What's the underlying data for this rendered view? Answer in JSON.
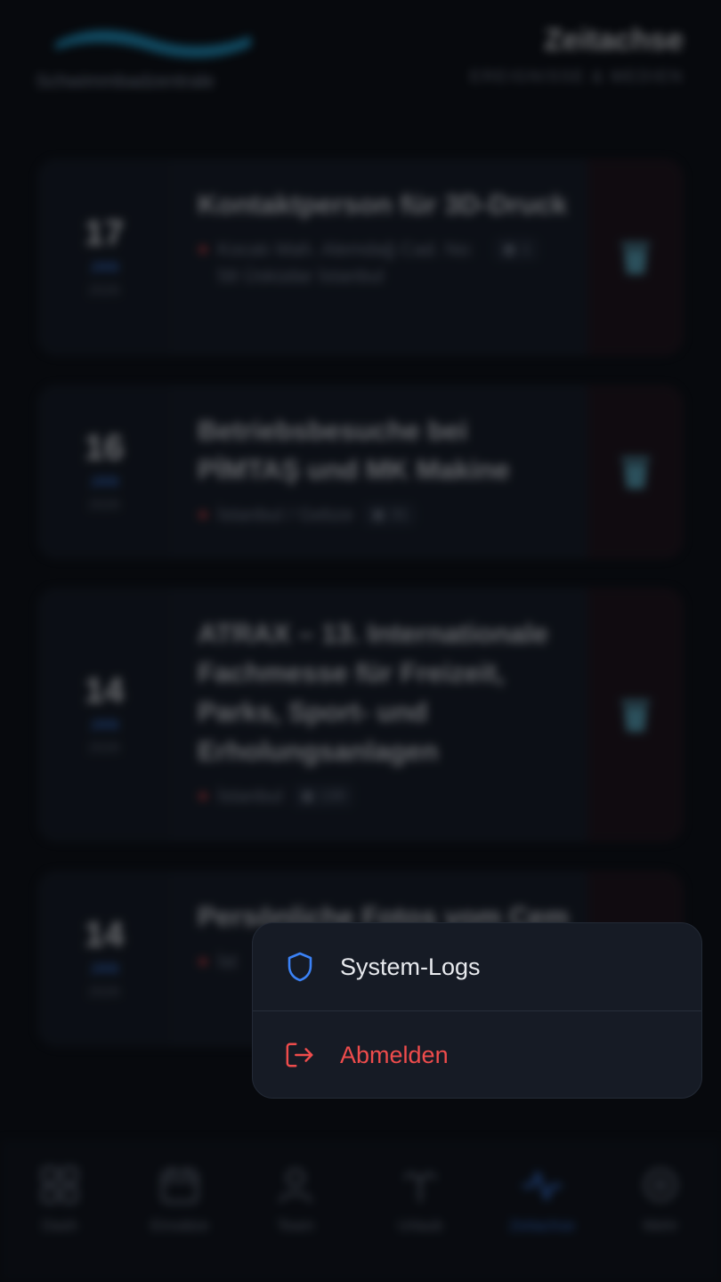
{
  "header": {
    "logo_text": "Schwimmbadzentrale",
    "title": "Zeitachse",
    "subtitle": "EREIGNISSE & MEDIEN"
  },
  "events": [
    {
      "day": "17",
      "month": "JAN",
      "year": "2026",
      "title": "Kontaktperson für 3D-Druck",
      "location": "Kocatı Mah. Alemdağ Cad. No: 58 Üsküdar İstanbul",
      "media": "1",
      "icon": "trash-icon"
    },
    {
      "day": "16",
      "month": "JAN",
      "year": "2026",
      "title": "Betriebsbesuche bei PİMTAŞ und MK Makine",
      "location": "İstanbul / Gebze",
      "media": "31",
      "icon": "trash-icon"
    },
    {
      "day": "14",
      "month": "JAN",
      "year": "2026",
      "title": "ATRAX – 13. Internationale Fachmesse für Freizeit, Parks, Sport- und Erholungsanlagen",
      "location": "İstanbul",
      "media": "130",
      "icon": "trash-icon"
    },
    {
      "day": "14",
      "month": "JAN",
      "year": "2026",
      "title": "Persönliche Fotos vom Cem",
      "location": "İst",
      "media": "",
      "icon": "trash-icon"
    }
  ],
  "nav": [
    {
      "label": "Dash",
      "icon": "grid-icon"
    },
    {
      "label": "Einsätze",
      "icon": "calendar-icon"
    },
    {
      "label": "Team",
      "icon": "user-icon"
    },
    {
      "label": "Urlaub",
      "icon": "palm-icon"
    },
    {
      "label": "Zeitachse",
      "icon": "activity-icon",
      "active": true
    },
    {
      "label": "Mehr",
      "icon": "gear-icon"
    }
  ],
  "menu": {
    "system_logs": "System-Logs",
    "logout": "Abmelden"
  },
  "colors": {
    "accent": "#3b82f6",
    "danger": "#ef4c4c",
    "menu_bg": "#161b25",
    "page_bg": "#07090d"
  }
}
